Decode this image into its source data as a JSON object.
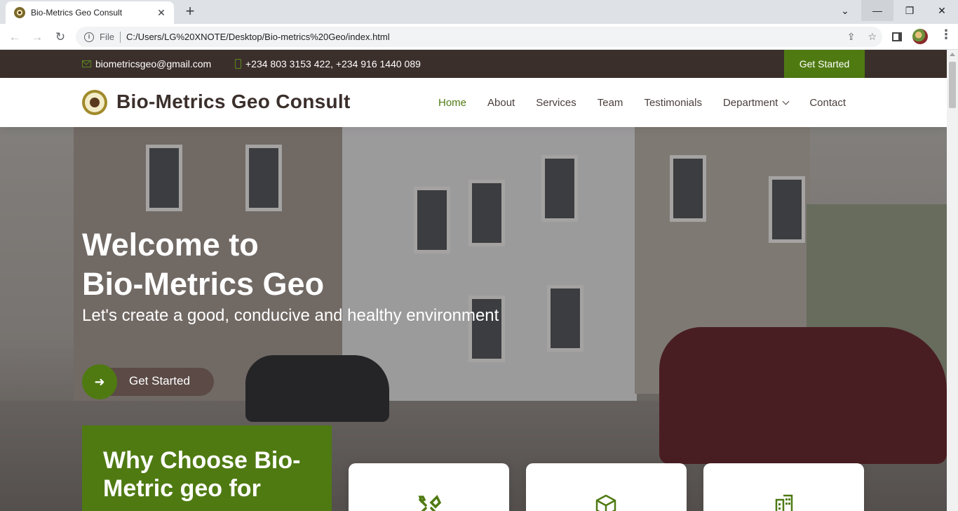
{
  "browser": {
    "tab_title": "Bio-Metrics Geo Consult",
    "tab_close": "✕",
    "new_tab": "+",
    "file_label": "File",
    "url": "C:/Users/LG%20XNOTE/Desktop/Bio-metrics%20Geo/index.html",
    "back": "←",
    "forward": "→",
    "reload": "↻",
    "share": "⇪",
    "bookmark": "☆",
    "menu": "⋮",
    "chevron": "⌄",
    "minimize": "—",
    "maximize": "❐",
    "close": "✕"
  },
  "topbar": {
    "email": "biometricsgeo@gmail.com",
    "phone": "+234 803 3153 422, +234 916 1440 089",
    "cta": "Get Started"
  },
  "header": {
    "brand": "Bio-Metrics Geo Consult",
    "nav": {
      "home": "Home",
      "about": "About",
      "services": "Services",
      "team": "Team",
      "testimonials": "Testimonials",
      "department": "Department",
      "contact": "Contact"
    }
  },
  "hero": {
    "title_line1": "Welcome to",
    "title_line2": "Bio-Metrics Geo",
    "subtitle": "Let's create a good, conducive and healthy environment",
    "cta": "Get Started",
    "cta_arrow": "➜"
  },
  "why": {
    "title_line1": "Why Choose Bio-",
    "title_line2": "Metric geo for"
  },
  "cards": {
    "icons": [
      "tools-icon",
      "cube-icon",
      "building-icon"
    ]
  },
  "colors": {
    "brand_green": "#4f7a12",
    "dark_brown": "#3b2f2b"
  }
}
